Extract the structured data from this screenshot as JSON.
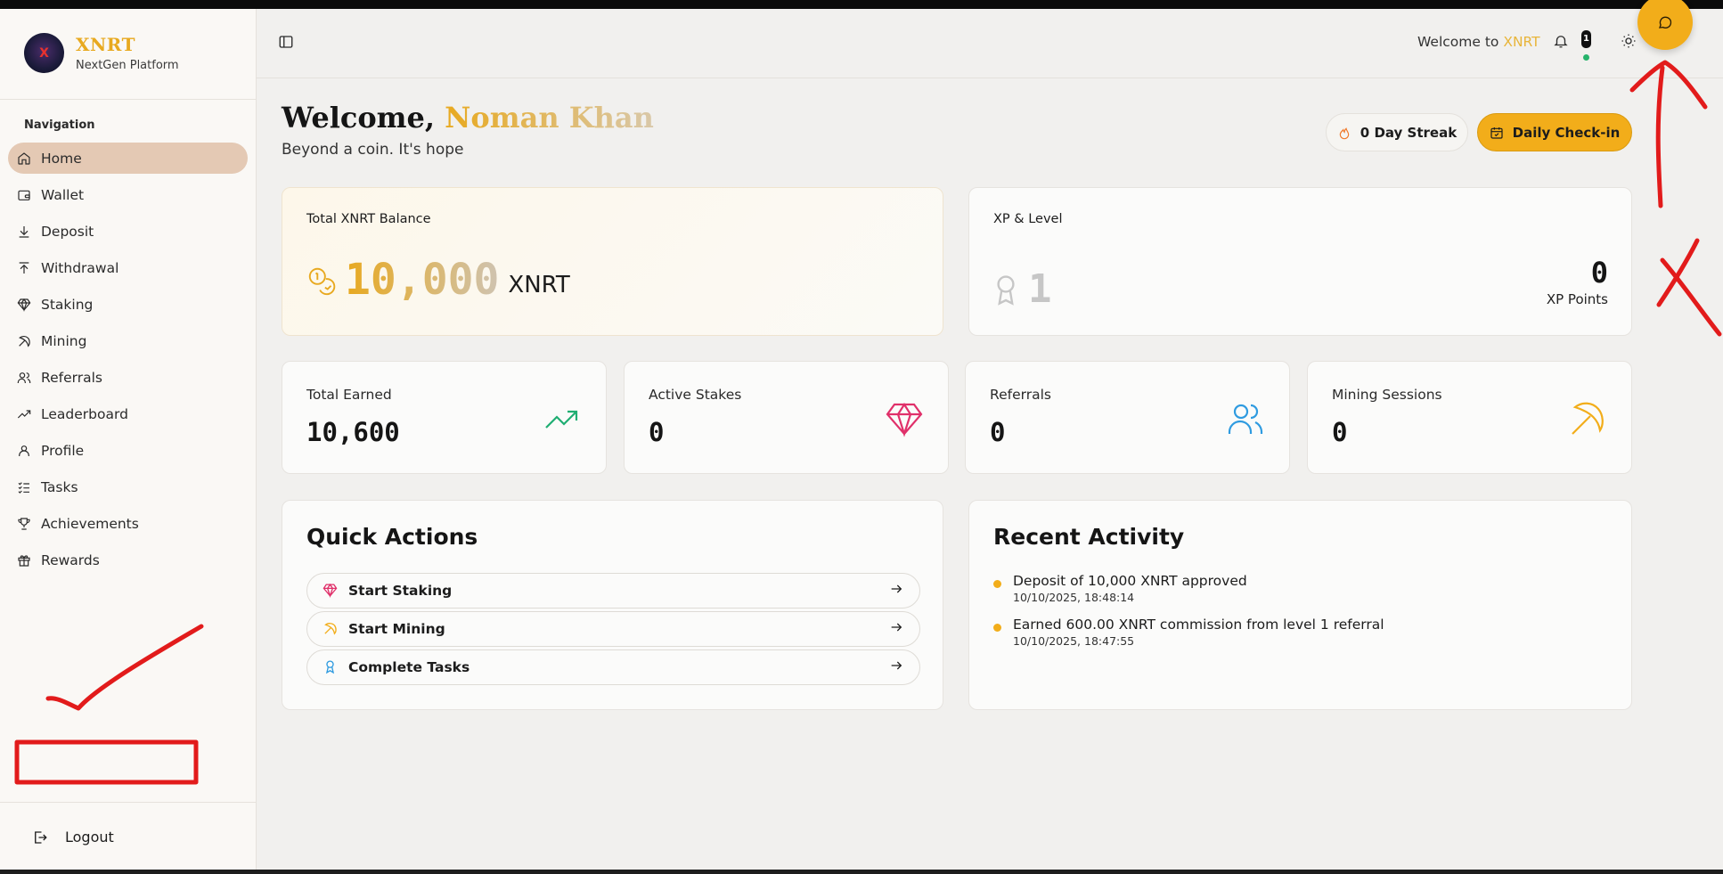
{
  "brand": {
    "name": "XNRT",
    "subtitle": "NextGen Platform",
    "logo_text": "X"
  },
  "sidebar": {
    "heading": "Navigation",
    "items": [
      {
        "label": "Home",
        "icon": "home-icon",
        "active": true
      },
      {
        "label": "Wallet",
        "icon": "wallet-icon"
      },
      {
        "label": "Deposit",
        "icon": "download-icon"
      },
      {
        "label": "Withdrawal",
        "icon": "upload-icon"
      },
      {
        "label": "Staking",
        "icon": "gem-icon"
      },
      {
        "label": "Mining",
        "icon": "pickaxe-icon"
      },
      {
        "label": "Referrals",
        "icon": "users-icon"
      },
      {
        "label": "Leaderboard",
        "icon": "trending-icon"
      },
      {
        "label": "Profile",
        "icon": "user-icon"
      },
      {
        "label": "Tasks",
        "icon": "checklist-icon"
      },
      {
        "label": "Achievements",
        "icon": "trophy-icon"
      },
      {
        "label": "Rewards",
        "icon": "gift-icon"
      }
    ],
    "logout": "Logout"
  },
  "header": {
    "welcome_prefix": "Welcome to",
    "welcome_brand": "XNRT",
    "notification_count": "1"
  },
  "greeting": {
    "prefix": "Welcome,",
    "name": "Noman Khan",
    "tagline": "Beyond a coin. It's hope"
  },
  "actions": {
    "streak": "0 Day Streak",
    "checkin": "Daily Check-in"
  },
  "balance": {
    "label": "Total XNRT Balance",
    "value": "10,000",
    "unit": "XNRT"
  },
  "xp": {
    "label": "XP & Level",
    "level": "1",
    "points": "0",
    "points_label": "XP Points"
  },
  "stats": [
    {
      "label": "Total Earned",
      "value": "10,600",
      "icon": "trending-up-icon",
      "color": "#1fae72"
    },
    {
      "label": "Active Stakes",
      "value": "0",
      "icon": "gem-icon",
      "color": "#e0306a"
    },
    {
      "label": "Referrals",
      "value": "0",
      "icon": "users-icon",
      "color": "#2f9be0"
    },
    {
      "label": "Mining Sessions",
      "value": "0",
      "icon": "pickaxe-icon",
      "color": "#f2ad1a"
    }
  ],
  "quick_actions": {
    "title": "Quick Actions",
    "items": [
      {
        "label": "Start Staking",
        "icon": "gem-icon",
        "color": "#e0306a"
      },
      {
        "label": "Start Mining",
        "icon": "pickaxe-icon",
        "color": "#f2ad1a"
      },
      {
        "label": "Complete Tasks",
        "icon": "award-icon",
        "color": "#2f9be0"
      }
    ]
  },
  "recent_activity": {
    "title": "Recent Activity",
    "items": [
      {
        "text": "Deposit of 10,000 XNRT approved",
        "time": "10/10/2025, 18:48:14"
      },
      {
        "text": "Earned 600.00 XNRT commission from level 1 referral",
        "time": "10/10/2025, 18:47:55"
      }
    ]
  },
  "colors": {
    "accent": "#f2ad1a",
    "active_nav": "#e4c9b4",
    "annotation": "#e21b1b"
  }
}
